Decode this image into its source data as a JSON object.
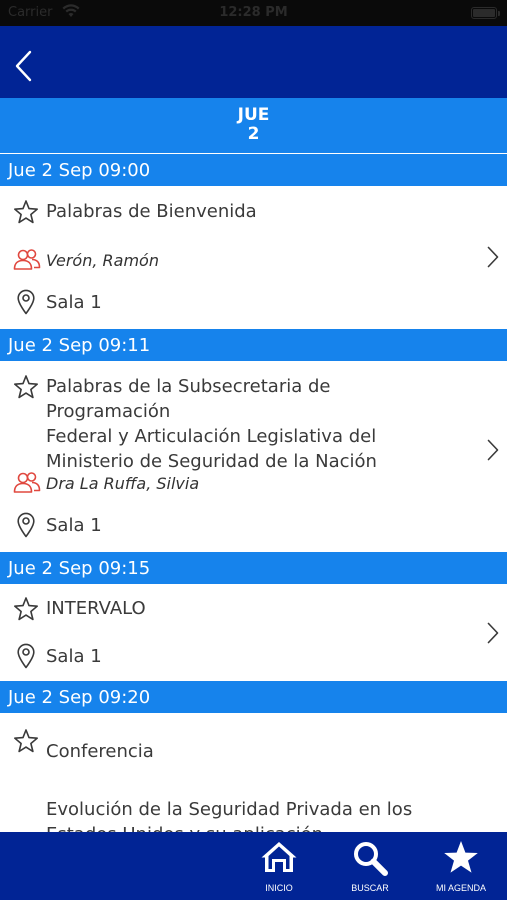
{
  "status_bar": {
    "carrier": "Carrier",
    "time": "12:28 PM"
  },
  "day_header": {
    "weekday": "JUE",
    "day": "2"
  },
  "sections": [
    {
      "header": "Jue 2 Sep 09:00",
      "event": {
        "title": "Palabras de Bienvenida",
        "speaker": "Verón, Ramón",
        "room": "Sala 1",
        "description": ""
      }
    },
    {
      "header": "Jue 2 Sep 09:11",
      "event": {
        "title": "Palabras de la Subsecretaria de Programación\nFederal y Articulación Legislativa del\nMinisterio de Seguridad de la Nación",
        "speaker": "Dra La Ruffa, Silvia",
        "room": "Sala 1",
        "description": ""
      }
    },
    {
      "header": "Jue 2 Sep 09:15",
      "event": {
        "title": "INTERVALO",
        "speaker": "",
        "room": "Sala 1",
        "description": ""
      }
    },
    {
      "header": "Jue 2 Sep 09:20",
      "event": {
        "title": "Conferencia",
        "speaker": "",
        "room": "",
        "description": "Evolución de la Seguridad Privada en los\nEstados Unidos y su aplicación"
      }
    }
  ],
  "tabs": [
    {
      "label": "INICIO",
      "icon": "home-icon"
    },
    {
      "label": "BUSCAR",
      "icon": "search-icon"
    },
    {
      "label": "MI AGENDA",
      "icon": "star-icon"
    }
  ],
  "colors": {
    "nav_background": "#012495",
    "section_blue": "#1683ec",
    "speaker_icon": "#e0483f",
    "text": "#3a3a3a"
  }
}
